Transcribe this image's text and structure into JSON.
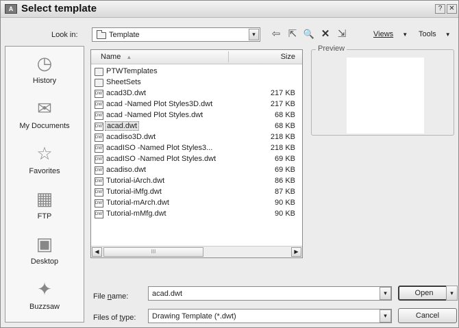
{
  "window": {
    "title": "Select template",
    "help_glyph": "?",
    "close_glyph": "✕",
    "app_icon_text": "A"
  },
  "look_in": {
    "label": "Look in:",
    "value": "Template"
  },
  "toolbar": {
    "back_glyph": "⇦",
    "up_glyph": "⇱",
    "search_glyph": "🔍",
    "delete_glyph": "✕",
    "new_folder_glyph": "⇲",
    "views_label": "Views",
    "tools_label": "Tools",
    "menu_caret": "▼"
  },
  "places": [
    {
      "label": "History",
      "icon": "history-icon",
      "glyph": "◷"
    },
    {
      "label": "My Documents",
      "icon": "documents-icon",
      "glyph": "✉"
    },
    {
      "label": "Favorites",
      "icon": "favorites-icon",
      "glyph": "☆"
    },
    {
      "label": "FTP",
      "icon": "ftp-icon",
      "glyph": "▦"
    },
    {
      "label": "Desktop",
      "icon": "desktop-icon",
      "glyph": "▣"
    },
    {
      "label": "Buzzsaw",
      "icon": "buzzsaw-icon",
      "glyph": "✦"
    }
  ],
  "file_list": {
    "columns": {
      "name": "Name",
      "size": "Size",
      "sort_glyph": "▲"
    },
    "rows": [
      {
        "name": "PTWTemplates",
        "size": "",
        "type": "folder"
      },
      {
        "name": "SheetSets",
        "size": "",
        "type": "folder"
      },
      {
        "name": "acad3D.dwt",
        "size": "217 KB",
        "type": "file"
      },
      {
        "name": "acad -Named Plot Styles3D.dwt",
        "size": "217 KB",
        "type": "file"
      },
      {
        "name": "acad -Named Plot Styles.dwt",
        "size": "68 KB",
        "type": "file"
      },
      {
        "name": "acad.dwt",
        "size": "68 KB",
        "type": "file",
        "selected": true
      },
      {
        "name": "acadiso3D.dwt",
        "size": "218 KB",
        "type": "file"
      },
      {
        "name": "acadISO -Named Plot Styles3...",
        "size": "218 KB",
        "type": "file"
      },
      {
        "name": "acadISO -Named Plot Styles.dwt",
        "size": "69 KB",
        "type": "file"
      },
      {
        "name": "acadiso.dwt",
        "size": "69 KB",
        "type": "file"
      },
      {
        "name": "Tutorial-iArch.dwt",
        "size": "86 KB",
        "type": "file"
      },
      {
        "name": "Tutorial-iMfg.dwt",
        "size": "87 KB",
        "type": "file"
      },
      {
        "name": "Tutorial-mArch.dwt",
        "size": "90 KB",
        "type": "file"
      },
      {
        "name": "Tutorial-mMfg.dwt",
        "size": "90 KB",
        "type": "file"
      }
    ],
    "file_icon_text": "DWT",
    "scroll_left": "◀",
    "scroll_right": "▶",
    "scroll_thumb": "III"
  },
  "preview": {
    "label": "Preview"
  },
  "file_name": {
    "label_pre": "File ",
    "label_key": "n",
    "label_post": "ame:",
    "value": "acad.dwt"
  },
  "file_type": {
    "label_pre": "Files of ",
    "label_key": "t",
    "label_post": "ype:",
    "value": "Drawing Template (*.dwt)"
  },
  "buttons": {
    "open": "Open",
    "cancel": "Cancel"
  },
  "dropdown_glyph": "▾"
}
